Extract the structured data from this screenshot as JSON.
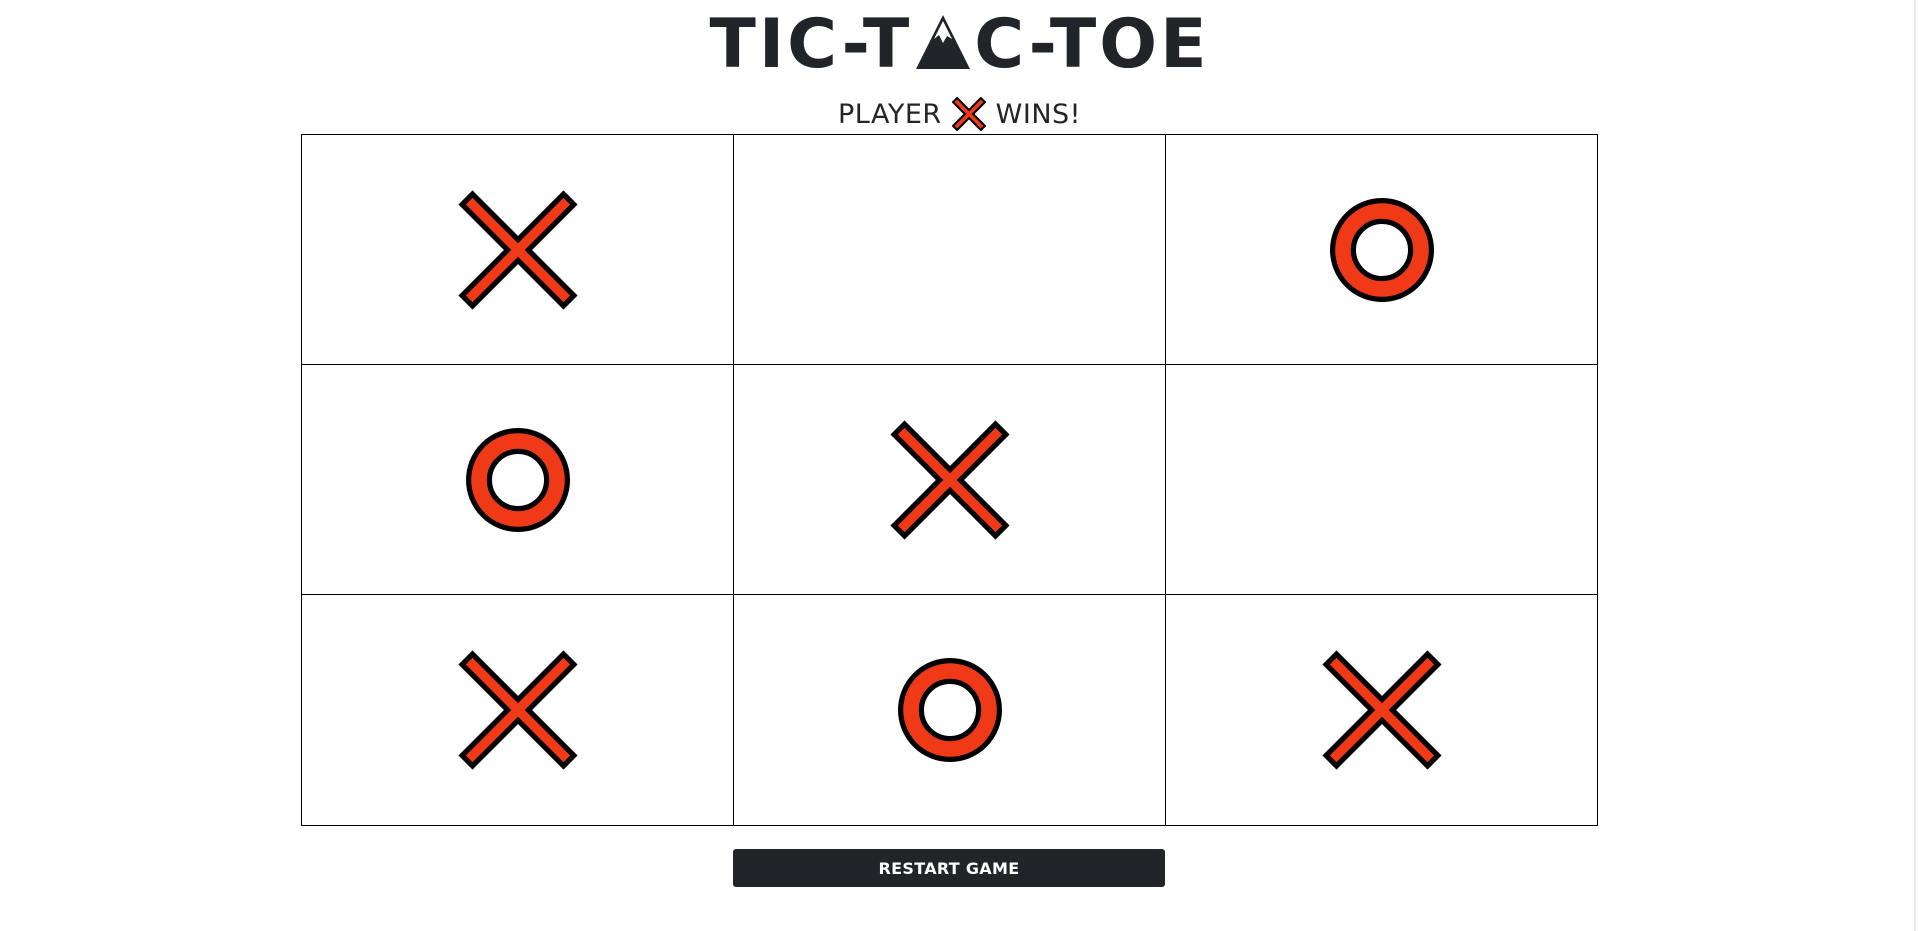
{
  "header": {
    "title_left": "TIC-T",
    "title_logo_icon": "mountain-a-icon",
    "title_right": "C-TOE"
  },
  "status": {
    "prefix": "PLAYER",
    "winner_icon": "x-mark-icon",
    "suffix": "WINS!"
  },
  "board": {
    "cells": [
      "X",
      "",
      "O",
      "O",
      "X",
      "",
      "X",
      "O",
      "X"
    ]
  },
  "colors": {
    "mark_fill": "#f03a17",
    "mark_outline": "#000000",
    "text": "#212529",
    "button_bg": "#212529",
    "button_text": "#ffffff"
  },
  "actions": {
    "restart_label": "RESTART GAME"
  }
}
